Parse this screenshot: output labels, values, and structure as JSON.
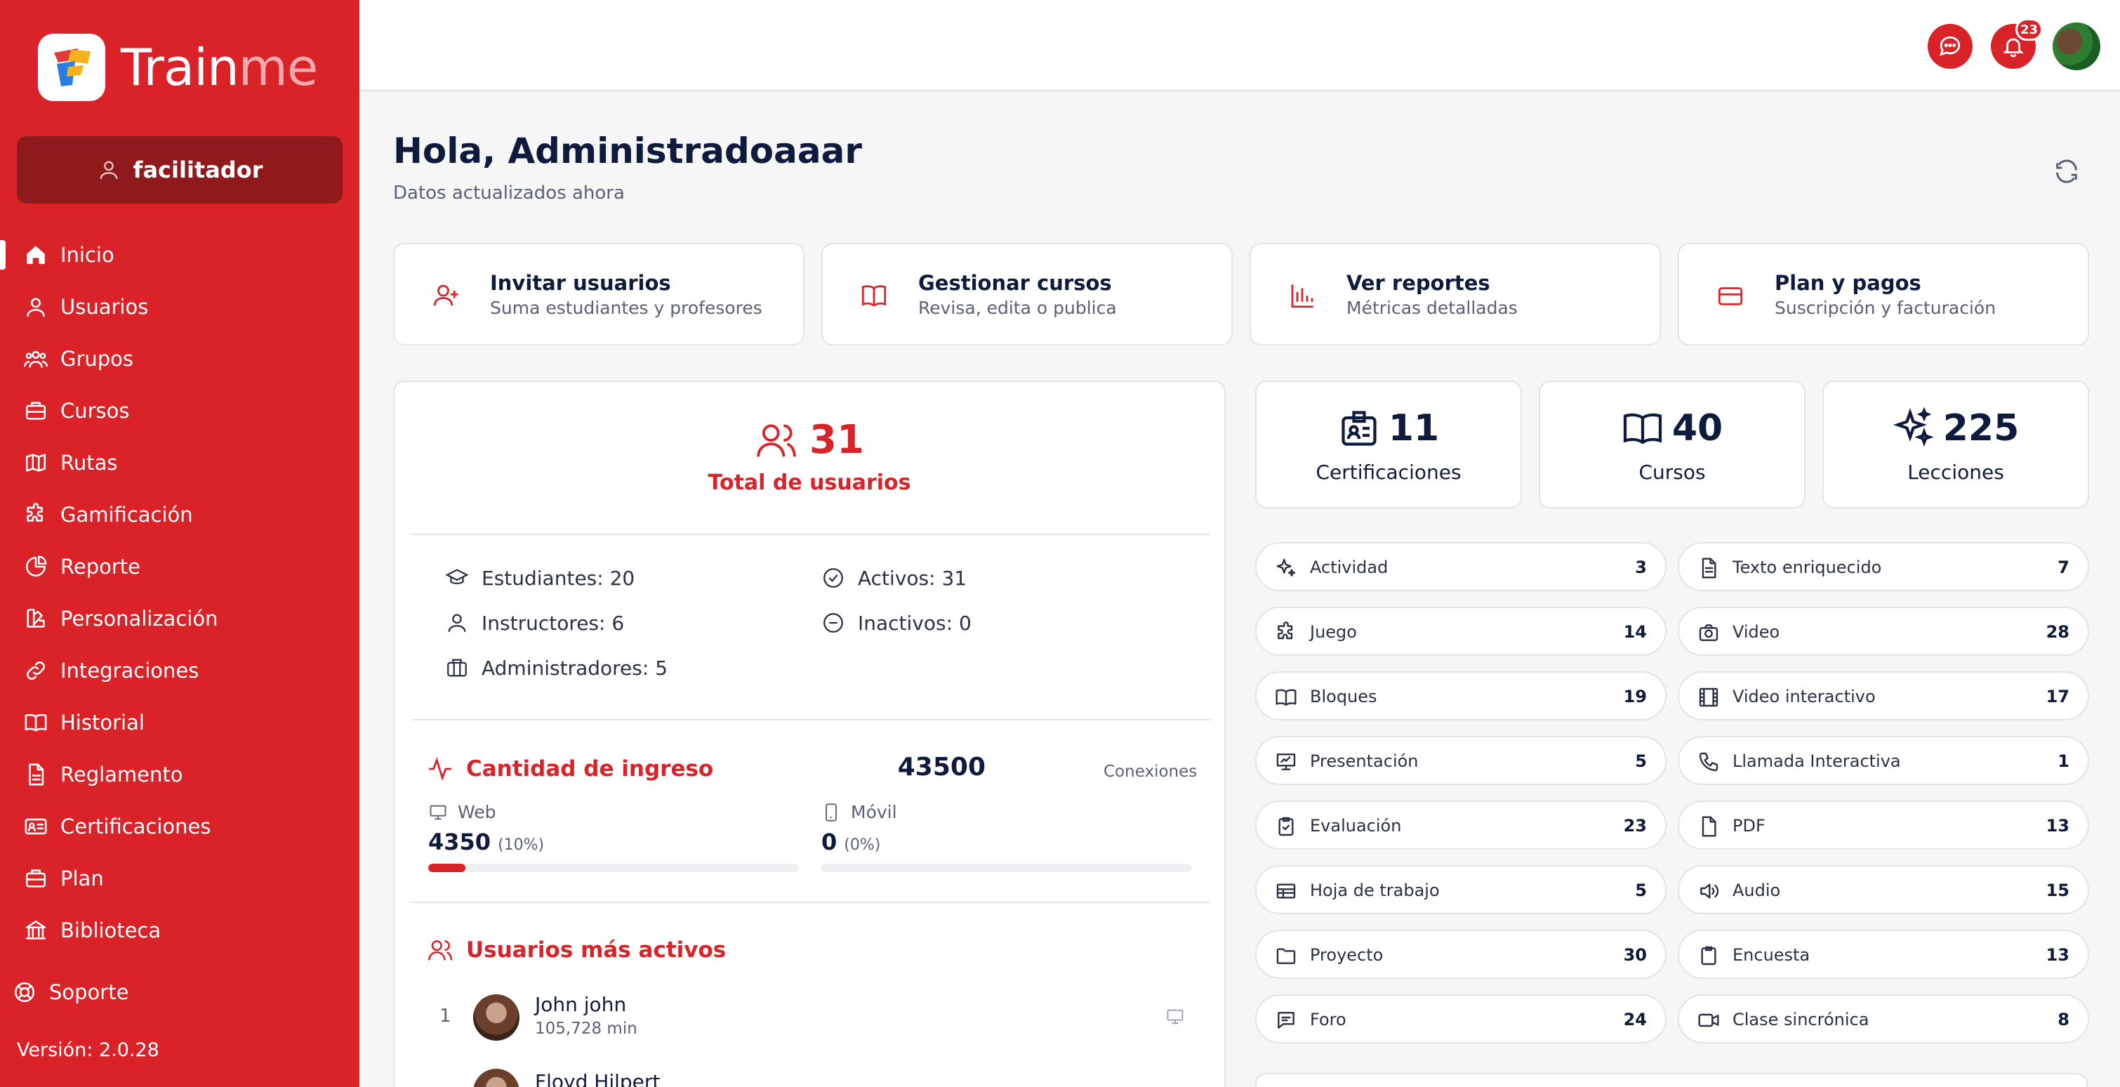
{
  "brand": {
    "name_a": "Train",
    "name_b": "me"
  },
  "role": "facilitador",
  "nav": [
    {
      "label": "Inicio",
      "icon": "home-icon"
    },
    {
      "label": "Usuarios",
      "icon": "user-icon"
    },
    {
      "label": "Grupos",
      "icon": "users-icon"
    },
    {
      "label": "Cursos",
      "icon": "briefcase-icon"
    },
    {
      "label": "Rutas",
      "icon": "map-icon"
    },
    {
      "label": "Gamificación",
      "icon": "puzzle-icon"
    },
    {
      "label": "Reporte",
      "icon": "pie-chart-icon"
    },
    {
      "label": "Personalización",
      "icon": "palette-icon"
    },
    {
      "label": "Integraciones",
      "icon": "link-icon"
    },
    {
      "label": "Historial",
      "icon": "book-open-icon"
    },
    {
      "label": "Reglamento",
      "icon": "document-icon"
    },
    {
      "label": "Certificaciones",
      "icon": "id-card-icon"
    },
    {
      "label": "Plan",
      "icon": "briefcase-icon"
    },
    {
      "label": "Biblioteca",
      "icon": "library-icon"
    }
  ],
  "support": "Soporte",
  "version": "Versión: 2.0.28",
  "notifications_count": "23",
  "header": {
    "greeting": "Hola, Administradoaaar",
    "updated": "Datos actualizados ahora"
  },
  "quick_actions": [
    {
      "title": "Invitar usuarios",
      "subtitle": "Suma estudiantes y profesores",
      "icon": "user-plus-icon"
    },
    {
      "title": "Gestionar cursos",
      "subtitle": "Revisa, edita o publica",
      "icon": "book-icon"
    },
    {
      "title": "Ver reportes",
      "subtitle": "Métricas detalladas",
      "icon": "bar-chart-icon"
    },
    {
      "title": "Plan y pagos",
      "subtitle": "Suscripción y facturación",
      "icon": "credit-card-icon"
    }
  ],
  "users": {
    "total": "31",
    "total_label": "Total de usuarios",
    "students": "Estudiantes: 20",
    "instructors": "Instructores: 6",
    "admins": "Administradores: 5",
    "active": "Activos: 31",
    "inactive": "Inactivos: 0"
  },
  "ingreso": {
    "title": "Cantidad de ingreso",
    "connections": "43500",
    "connections_label": "Conexiones",
    "web_label": "Web",
    "web_value": "4350",
    "web_pct": "(10%)",
    "web_fraction": 0.1,
    "mobile_label": "Móvil",
    "mobile_value": "0",
    "mobile_pct": "(0%)",
    "mobile_fraction": 0
  },
  "active_users": {
    "title": "Usuarios más activos",
    "rows": [
      {
        "rank": "1",
        "name": "John john",
        "minutes": "105,728 min"
      },
      {
        "name": "Floyd Hilpert"
      }
    ]
  },
  "kpis": [
    {
      "value": "11",
      "label": "Certificaciones",
      "icon": "id-badge-icon"
    },
    {
      "value": "40",
      "label": "Cursos",
      "icon": "book-open-icon"
    },
    {
      "value": "225",
      "label": "Lecciones",
      "icon": "sparkles-icon"
    }
  ],
  "content_types_left": [
    {
      "label": "Actividad",
      "count": "3",
      "icon": "sparkle-icon"
    },
    {
      "label": "Juego",
      "count": "14",
      "icon": "puzzle-icon"
    },
    {
      "label": "Bloques",
      "count": "19",
      "icon": "book-open-icon"
    },
    {
      "label": "Presentación",
      "count": "5",
      "icon": "presentation-icon"
    },
    {
      "label": "Evaluación",
      "count": "23",
      "icon": "clipboard-check-icon"
    },
    {
      "label": "Hoja de trabajo",
      "count": "5",
      "icon": "table-icon"
    },
    {
      "label": "Proyecto",
      "count": "30",
      "icon": "folder-icon"
    },
    {
      "label": "Foro",
      "count": "24",
      "icon": "chat-icon"
    }
  ],
  "content_types_right": [
    {
      "label": "Texto enriquecido",
      "count": "7",
      "icon": "file-text-icon"
    },
    {
      "label": "Video",
      "count": "28",
      "icon": "camera-icon"
    },
    {
      "label": "Video interactivo",
      "count": "17",
      "icon": "film-icon"
    },
    {
      "label": "Llamada Interactiva",
      "count": "1",
      "icon": "phone-icon"
    },
    {
      "label": "PDF",
      "count": "13",
      "icon": "file-icon"
    },
    {
      "label": "Audio",
      "count": "15",
      "icon": "speaker-icon"
    },
    {
      "label": "Encuesta",
      "count": "13",
      "icon": "clipboard-icon"
    },
    {
      "label": "Clase sincrónica",
      "count": "8",
      "icon": "video-icon"
    }
  ],
  "colors": {
    "brand": "#d92328",
    "brand_dark": "#8e1a1c",
    "text": "#0f1b3d"
  }
}
